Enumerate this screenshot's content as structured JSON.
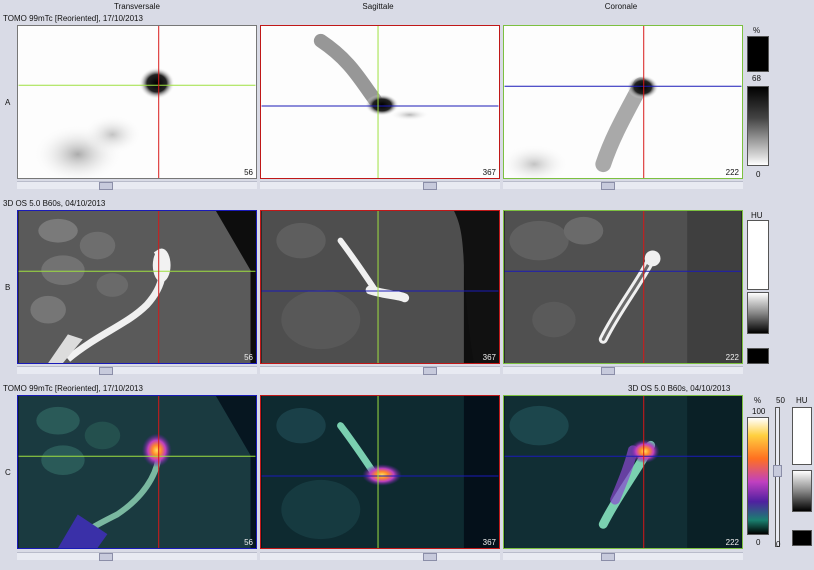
{
  "columns": {
    "transversale": "Transversale",
    "sagittale": "Sagittale",
    "coronale": "Coronale"
  },
  "rows": {
    "a": {
      "letter": "A",
      "header": "TOMO 99mTc [Reoriented], 17/10/2013"
    },
    "b": {
      "letter": "B",
      "header": "3D  OS  5.0  B60s, 04/10/2013"
    },
    "c": {
      "letter": "C",
      "header_left": "TOMO 99mTc [Reoriented], 17/10/2013",
      "header_right": "3D  OS  5.0  B60s, 04/10/2013"
    }
  },
  "slices": {
    "transversale": "56",
    "sagittale": "367",
    "coronale": "222"
  },
  "scales": {
    "a": {
      "unit": "%",
      "mid": "68",
      "bottom": "0"
    },
    "b": {
      "unit": "HU"
    },
    "c": {
      "unit": "%",
      "top": "100",
      "bottom": "0",
      "mid_unit": "50",
      "mid_bottom": "0",
      "hu_unit": "HU"
    }
  },
  "colors": {
    "crosshair_red": "#d81818",
    "crosshair_green": "#9ee040",
    "crosshair_blue": "#1a1ab8"
  }
}
